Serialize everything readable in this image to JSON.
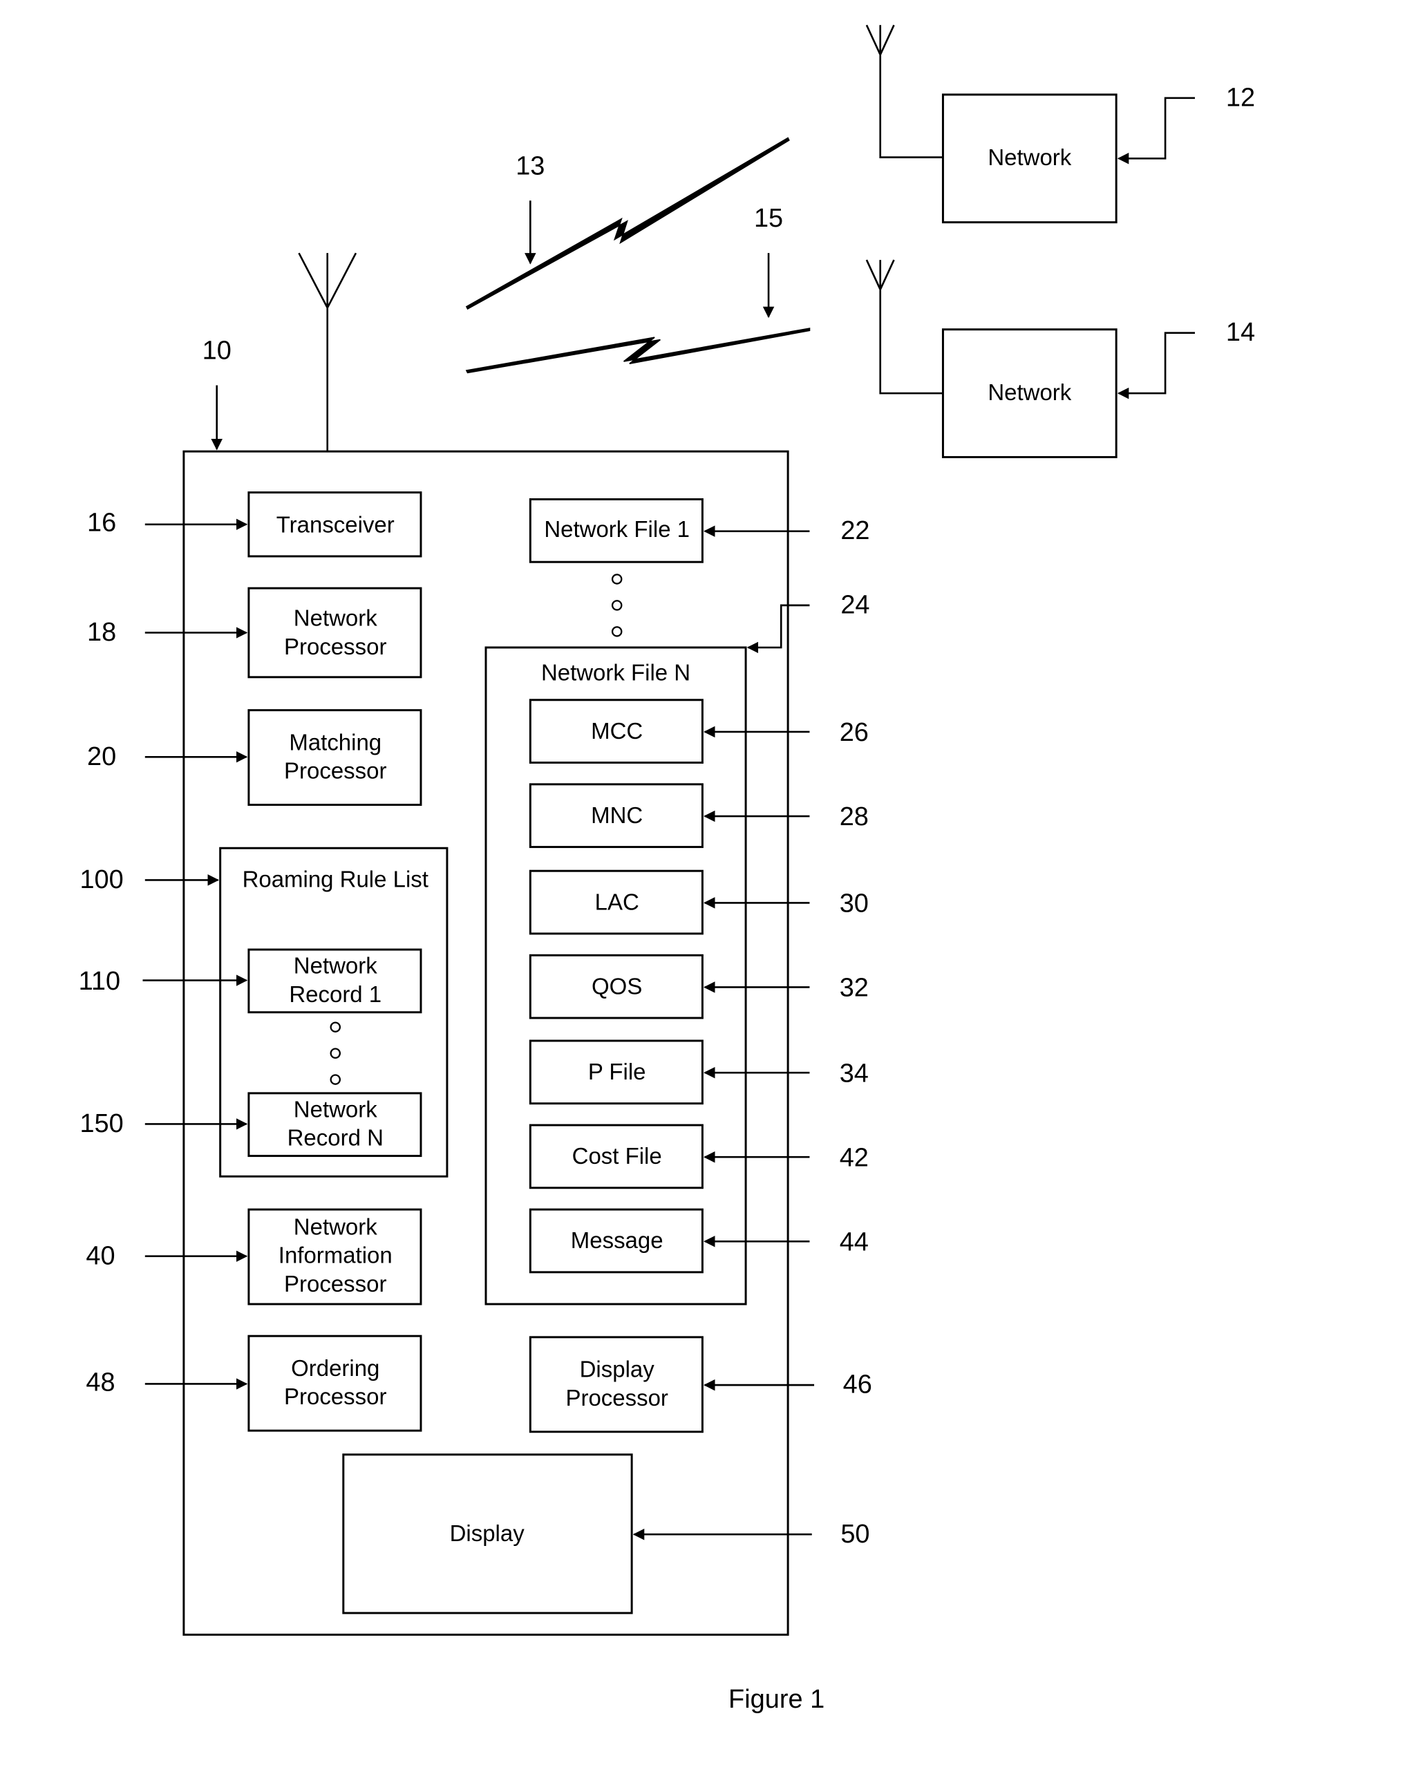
{
  "figure": {
    "caption": "Figure 1"
  },
  "networks": [
    {
      "ref": "12",
      "label": "Network"
    },
    {
      "ref": "14",
      "label": "Network"
    }
  ],
  "links": [
    {
      "ref": "13"
    },
    {
      "ref": "15"
    }
  ],
  "device": {
    "ref": "10",
    "left_blocks": [
      {
        "ref": "16",
        "lines": [
          "Transceiver"
        ]
      },
      {
        "ref": "18",
        "lines": [
          "Network",
          "Processor"
        ]
      },
      {
        "ref": "20",
        "lines": [
          "Matching",
          "Processor"
        ]
      },
      {
        "ref": "40",
        "lines": [
          "Network",
          "Information",
          "Processor"
        ]
      },
      {
        "ref": "48",
        "lines": [
          "Ordering",
          "Processor"
        ]
      }
    ],
    "roaming_rule_list": {
      "ref": "100",
      "title": "Roaming Rule List",
      "records": [
        {
          "ref": "110",
          "lines": [
            "Network",
            "Record 1"
          ]
        },
        {
          "ref": "150",
          "lines": [
            "Network",
            "Record N"
          ]
        }
      ]
    },
    "network_file_1": {
      "ref": "22",
      "label": "Network File 1"
    },
    "network_file_n": {
      "ref": "24",
      "title": "Network File N",
      "fields": [
        {
          "ref": "26",
          "label": "MCC"
        },
        {
          "ref": "28",
          "label": "MNC"
        },
        {
          "ref": "30",
          "label": "LAC"
        },
        {
          "ref": "32",
          "label": "QOS"
        },
        {
          "ref": "34",
          "label": "P File"
        },
        {
          "ref": "42",
          "label": "Cost File"
        },
        {
          "ref": "44",
          "label": "Message"
        }
      ]
    },
    "display_processor": {
      "ref": "46",
      "lines": [
        "Display",
        "Processor"
      ]
    },
    "display": {
      "ref": "50",
      "label": "Display"
    }
  }
}
